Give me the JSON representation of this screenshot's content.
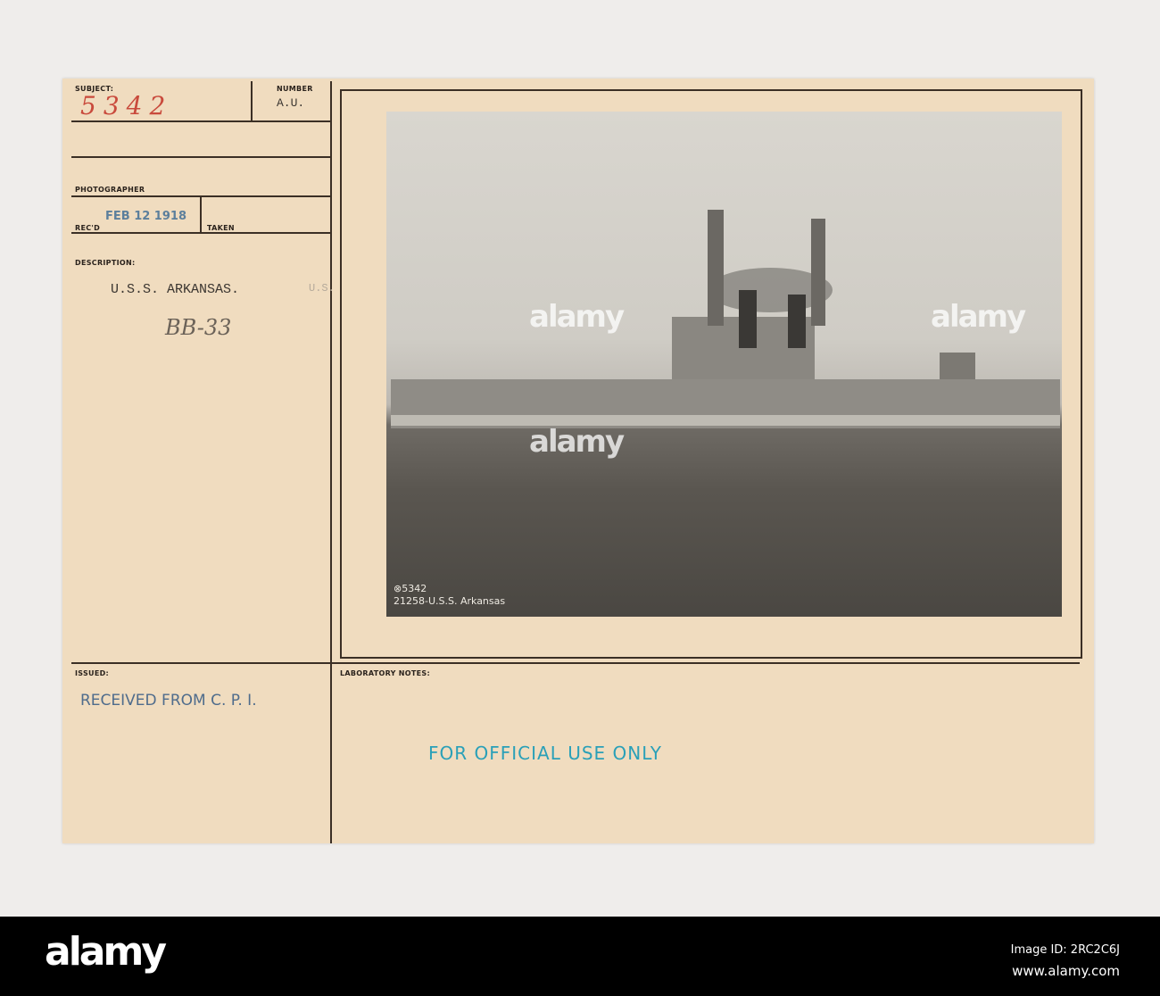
{
  "card": {
    "subject_label": "SUBJECT:",
    "subject_value": "5342",
    "number_label": "NUMBER",
    "number_value": "A.U.",
    "photographer_label": "PHOTOGRAPHER",
    "recd_label": "REC'D",
    "recd_stamp": "FEB 12 1918",
    "taken_label": "TAKEN",
    "description_label": "DESCRIPTION:",
    "description_value": "U.S.S. ARKANSAS.",
    "description_extra": "U.S.",
    "hull_note": "BB-33",
    "issued_label": "ISSUED:",
    "issued_value": "RECEIVED FROM C. P. I.",
    "lab_notes_label": "LABORATORY NOTES:",
    "official_stamp": "FOR OFFICIAL USE ONLY"
  },
  "photo": {
    "caption_line1": "⊗5342",
    "caption_line2": "21258-U.S.S. Arkansas",
    "watermark": "alamy"
  },
  "footer": {
    "logo": "alamy",
    "image_id": "Image ID: 2RC2C6J",
    "url": "www.alamy.com"
  },
  "colors": {
    "stamp_blue": "#5c7f9c",
    "handwriting_red": "#c94a3c",
    "official_teal": "#2aa0b8"
  }
}
